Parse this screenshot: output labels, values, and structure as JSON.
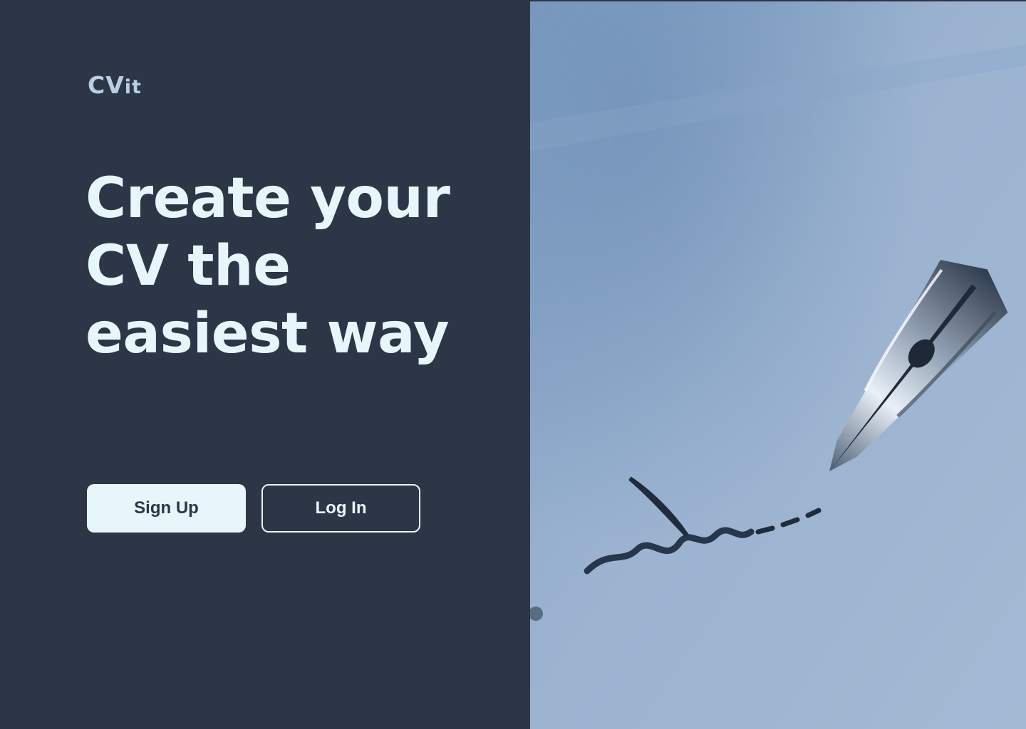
{
  "brand": {
    "logo_main": "CV",
    "logo_suffix": "it"
  },
  "hero": {
    "line1": "Create your",
    "line2": "CV the",
    "line3": "easiest way"
  },
  "actions": {
    "signup_label": "Sign Up",
    "login_label": "Log In"
  },
  "image": {
    "subject": "fountain-pen-writing-photo"
  },
  "colors": {
    "panel_bg": "#2d3647",
    "headline": "#e7f6fb",
    "logo": "#b8cee5",
    "button_fill": "#e6f6fb"
  }
}
